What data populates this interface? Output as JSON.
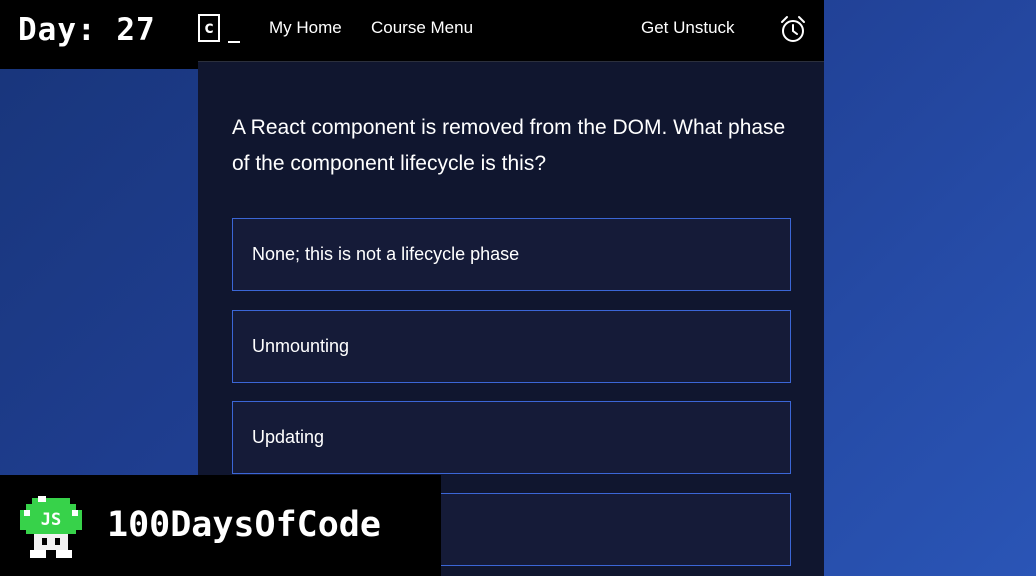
{
  "header": {
    "logo_letter": "c",
    "nav_home": "My Home",
    "nav_course_menu": "Course Menu",
    "nav_get_unstuck": "Get Unstuck",
    "alarm_icon": "alarm-clock-icon"
  },
  "overlay": {
    "day_label": "Day:",
    "day_number": "27",
    "badge_label": "100DaysOfCode",
    "badge_icon_text": "JS"
  },
  "quiz": {
    "question": "A React component is removed from the DOM. What phase of the component lifecycle is this?",
    "options": [
      "None; this is not a lifecycle phase",
      "Unmounting",
      "Updating",
      ""
    ]
  },
  "colors": {
    "panel": "#10162f",
    "option_border": "#3b66d6",
    "badge_green": "#37d24a"
  }
}
